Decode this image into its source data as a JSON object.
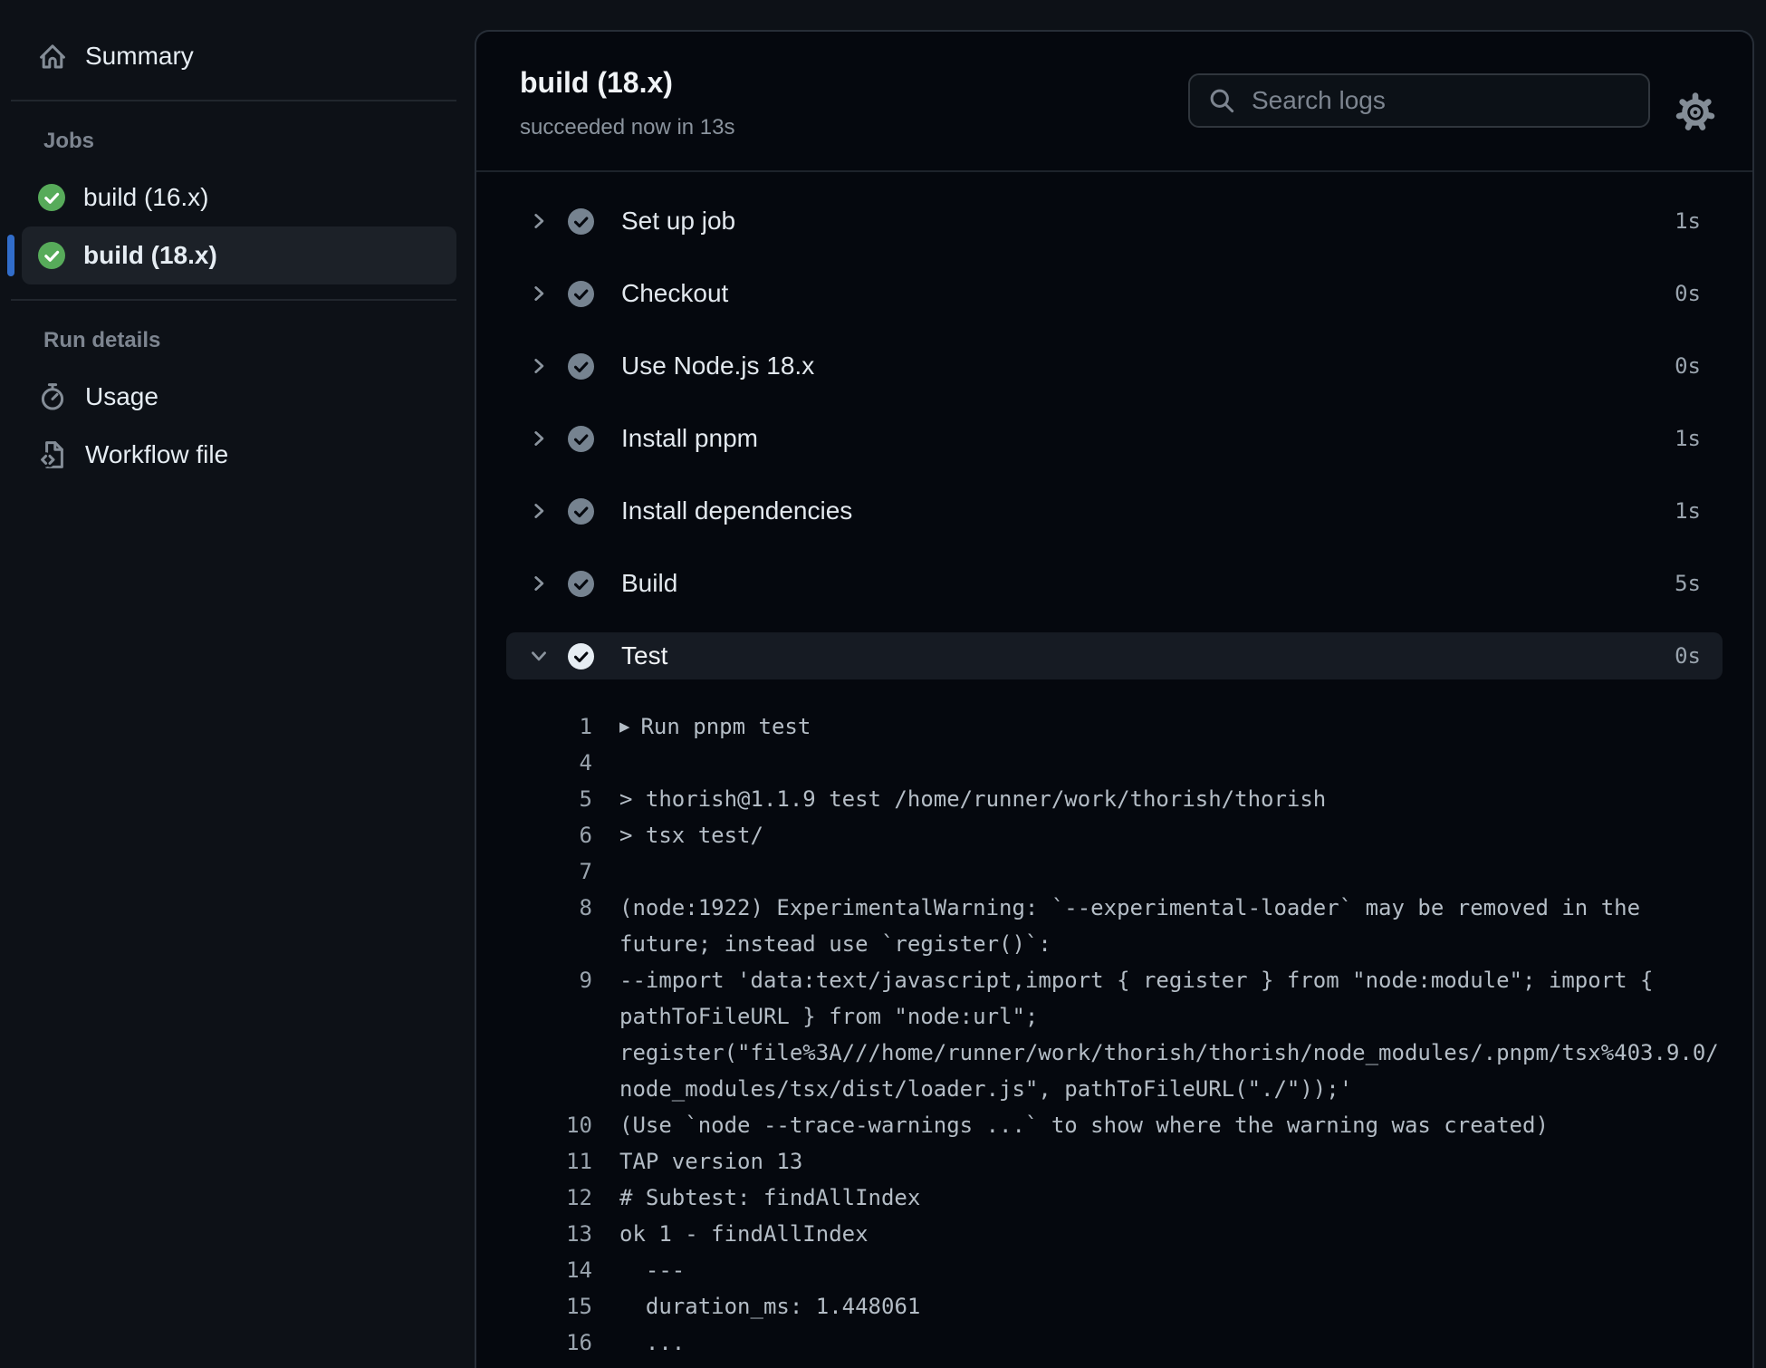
{
  "sidebar": {
    "summary": {
      "label": "Summary",
      "icon": "home-icon"
    },
    "jobs_heading": "Jobs",
    "jobs": [
      {
        "label": "build (16.x)",
        "status": "success",
        "icon": "check-circle-icon",
        "selected": false
      },
      {
        "label": "build (18.x)",
        "status": "success",
        "icon": "check-circle-icon",
        "selected": true
      }
    ],
    "run_details_heading": "Run details",
    "run_details": [
      {
        "label": "Usage",
        "icon": "stopwatch-icon"
      },
      {
        "label": "Workflow file",
        "icon": "file-code-icon"
      }
    ]
  },
  "header": {
    "title": "build (18.x)",
    "status_line": "succeeded now in 13s",
    "search_placeholder": "Search logs",
    "search_value": "",
    "settings_icon": "gear-icon"
  },
  "steps": [
    {
      "label": "Set up job",
      "duration": "1s",
      "status": "success",
      "expanded": false
    },
    {
      "label": "Checkout",
      "duration": "0s",
      "status": "success",
      "expanded": false
    },
    {
      "label": "Use Node.js 18.x",
      "duration": "0s",
      "status": "success",
      "expanded": false
    },
    {
      "label": "Install pnpm",
      "duration": "1s",
      "status": "success",
      "expanded": false
    },
    {
      "label": "Install dependencies",
      "duration": "1s",
      "status": "success",
      "expanded": false
    },
    {
      "label": "Build",
      "duration": "5s",
      "status": "success",
      "expanded": false
    },
    {
      "label": "Test",
      "duration": "0s",
      "status": "success",
      "expanded": true
    }
  ],
  "log": {
    "lines": [
      {
        "n": "1",
        "text": "Run pnpm test",
        "cmd": true
      },
      {
        "n": "4",
        "text": ""
      },
      {
        "n": "5",
        "text": "> thorish@1.1.9 test /home/runner/work/thorish/thorish"
      },
      {
        "n": "6",
        "text": "> tsx test/"
      },
      {
        "n": "7",
        "text": ""
      },
      {
        "n": "8",
        "text": "(node:1922) ExperimentalWarning: `--experimental-loader` may be removed in the future; instead use `register()`:"
      },
      {
        "n": "9",
        "text": "--import 'data:text/javascript,import { register } from \"node:module\"; import { pathToFileURL } from \"node:url\"; register(\"file%3A///home/runner/work/thorish/thorish/node_modules/.pnpm/tsx%403.9.0/node_modules/tsx/dist/loader.js\", pathToFileURL(\"./\"));'"
      },
      {
        "n": "10",
        "text": "(Use `node --trace-warnings ...` to show where the warning was created)"
      },
      {
        "n": "11",
        "text": "TAP version 13"
      },
      {
        "n": "12",
        "text": "# Subtest: findAllIndex"
      },
      {
        "n": "13",
        "text": "ok 1 - findAllIndex"
      },
      {
        "n": "14",
        "text": "  ---"
      },
      {
        "n": "15",
        "text": "  duration_ms: 1.448061"
      },
      {
        "n": "16",
        "text": "  ..."
      }
    ]
  },
  "colors": {
    "page_bg": "#0d1117",
    "panel_bg": "#05080e",
    "panel_border": "#272e37",
    "accent_blue": "#316dca",
    "success_green": "#57ab5a",
    "step_check_gray": "#768390",
    "row_highlight": "#161b23",
    "text_primary": "#e6edf3",
    "text_muted": "#8b949e"
  }
}
